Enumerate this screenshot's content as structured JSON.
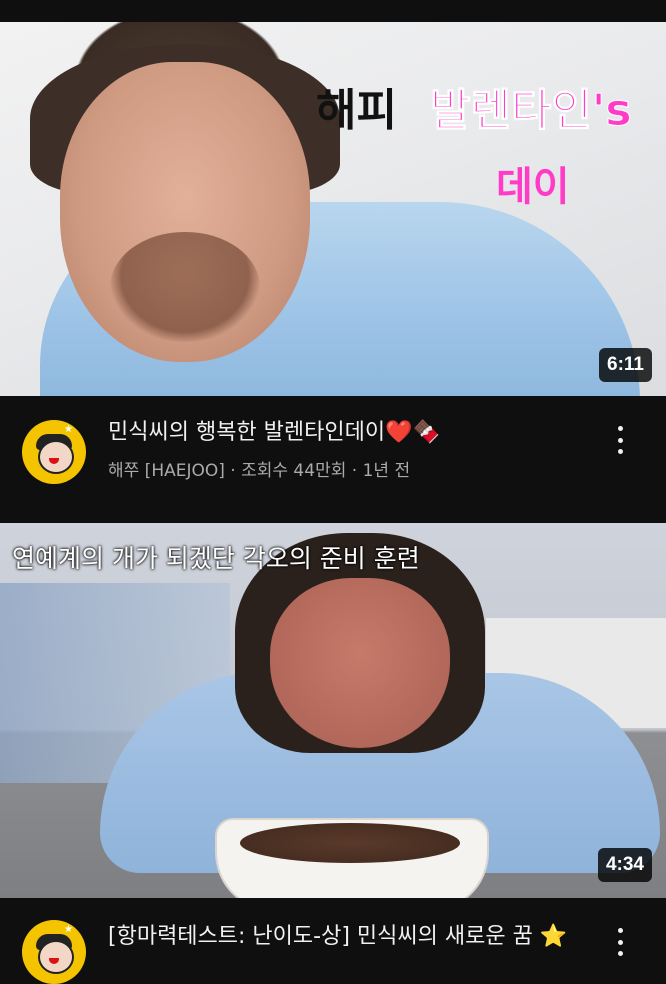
{
  "videos": [
    {
      "thumbnail_text": {
        "line1_black": "해피",
        "line1_pink": "발렌타인's",
        "line2_pink": "데이"
      },
      "duration": "6:11",
      "title": "민식씨의 행복한 발렌타인데이",
      "title_emojis": [
        "❤️",
        "🍫"
      ],
      "channel": "해쭈 [HAEJOO]",
      "views": "조회수 44만회",
      "age": "1년 전",
      "separator": " · "
    },
    {
      "thumbnail_text": {
        "overlay": "연예계의 개가 되겠단 각오의 준비 훈련"
      },
      "duration": "4:34",
      "title": "[항마력테스트: 난이도-상] 민식씨의 새로운 꿈",
      "title_emojis": [
        "⭐"
      ]
    }
  ],
  "icons": {
    "avatar": "channel-avatar-icon",
    "more": "more-vert-icon"
  },
  "colors": {
    "background": "#0f0f0f",
    "text_primary": "#f1f1f1",
    "text_secondary": "#aaaaaa",
    "thumbnail_pink": "#ff3bc8",
    "avatar_bg": "#f5c400"
  }
}
